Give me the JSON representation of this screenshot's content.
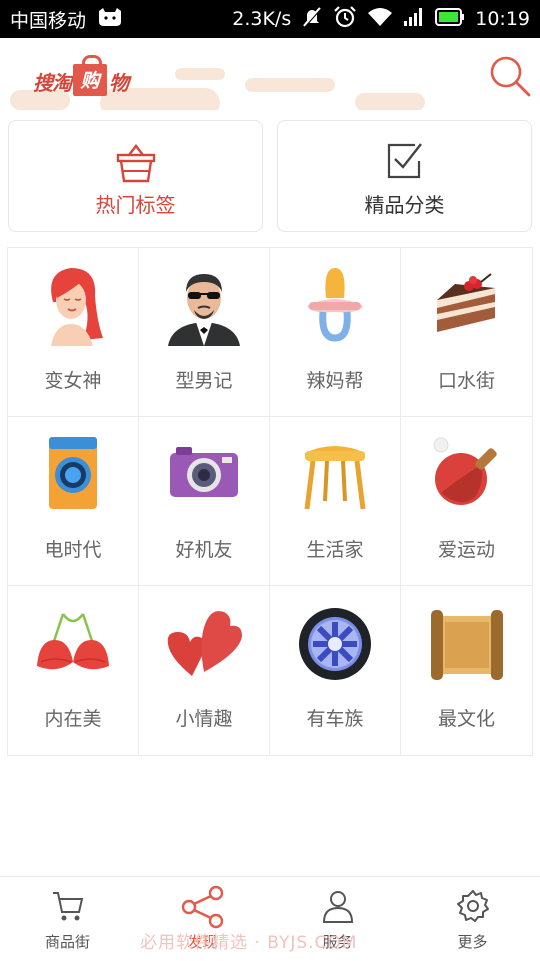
{
  "status_bar": {
    "carrier": "中国移动",
    "speed": "2.3K/s",
    "time": "10:19"
  },
  "header": {
    "logo_text_left": "搜淘",
    "logo_text_bag": "购",
    "logo_text_right": "物"
  },
  "top_cards": [
    {
      "label": "热门标签",
      "color": "#d6453a",
      "icon": "basket-icon"
    },
    {
      "label": "精品分类",
      "color": "#333333",
      "icon": "checkbox-icon"
    }
  ],
  "categories": [
    {
      "label": "变女神",
      "icon": "woman-icon"
    },
    {
      "label": "型男记",
      "icon": "man-icon"
    },
    {
      "label": "辣妈帮",
      "icon": "pacifier-icon"
    },
    {
      "label": "口水街",
      "icon": "cake-icon"
    },
    {
      "label": "电时代",
      "icon": "washing-machine-icon"
    },
    {
      "label": "好机友",
      "icon": "camera-icon"
    },
    {
      "label": "生活家",
      "icon": "stool-icon"
    },
    {
      "label": "爱运动",
      "icon": "ping-pong-icon"
    },
    {
      "label": "内在美",
      "icon": "bra-icon"
    },
    {
      "label": "小情趣",
      "icon": "hearts-icon"
    },
    {
      "label": "有车族",
      "icon": "tire-icon"
    },
    {
      "label": "最文化",
      "icon": "scroll-icon"
    }
  ],
  "bottom_nav": [
    {
      "label": "商品街",
      "icon": "cart-icon",
      "active": false
    },
    {
      "label": "发现",
      "icon": "share-icon",
      "active": true
    },
    {
      "label": "服务",
      "icon": "person-icon",
      "active": false
    },
    {
      "label": "更多",
      "icon": "gear-icon",
      "active": false
    }
  ],
  "watermark": "必用软件精选 · BYJS.COM",
  "colors": {
    "accent": "#e25a4c",
    "border": "#e6e6e6",
    "grid_text": "#666666"
  }
}
